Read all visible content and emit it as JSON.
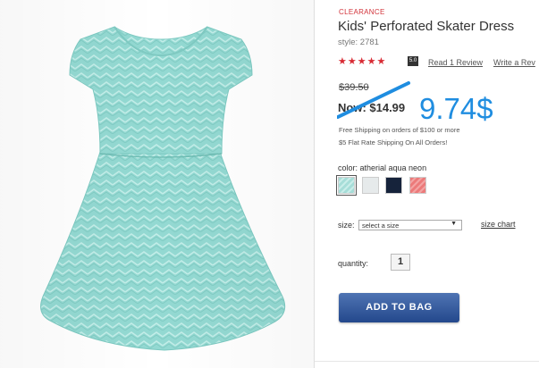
{
  "product": {
    "badge": "CLEARANCE",
    "title": "Kids' Perforated Skater Dress",
    "style": "style: 2781",
    "rating_stars": "★★★★★",
    "rating_score": "5.0",
    "read_review": "Read 1 Review",
    "write_review": "Write a Rev",
    "old_price": "$39.50",
    "now_price": "Now: $14.99",
    "annotated_price": "9.74$",
    "shipping_line1": "Free Shipping on orders of $100 or more",
    "shipping_line2": "$5 Flat Rate Shipping On All Orders!"
  },
  "color": {
    "label": "color: atherial aqua neon",
    "swatches": [
      {
        "name": "atherial aqua neon",
        "hex": "#a6ddd8",
        "selected": true
      },
      {
        "name": "white",
        "hex": "#e6eaeb",
        "selected": false
      },
      {
        "name": "navy",
        "hex": "#16233b",
        "selected": false
      },
      {
        "name": "coral",
        "hex": "#ec7a7a",
        "selected": false
      }
    ]
  },
  "size": {
    "label": "size:",
    "selected": "select a size",
    "chart_link": "size chart"
  },
  "quantity": {
    "label": "quantity:",
    "value": "1"
  },
  "actions": {
    "add_to_bag": "ADD TO BAG"
  },
  "colors": {
    "accent_red": "#d82b34",
    "annotation_blue": "#1f8de0",
    "button_blue": "#2f5597",
    "dress_aqua": "#8fd6cf"
  }
}
